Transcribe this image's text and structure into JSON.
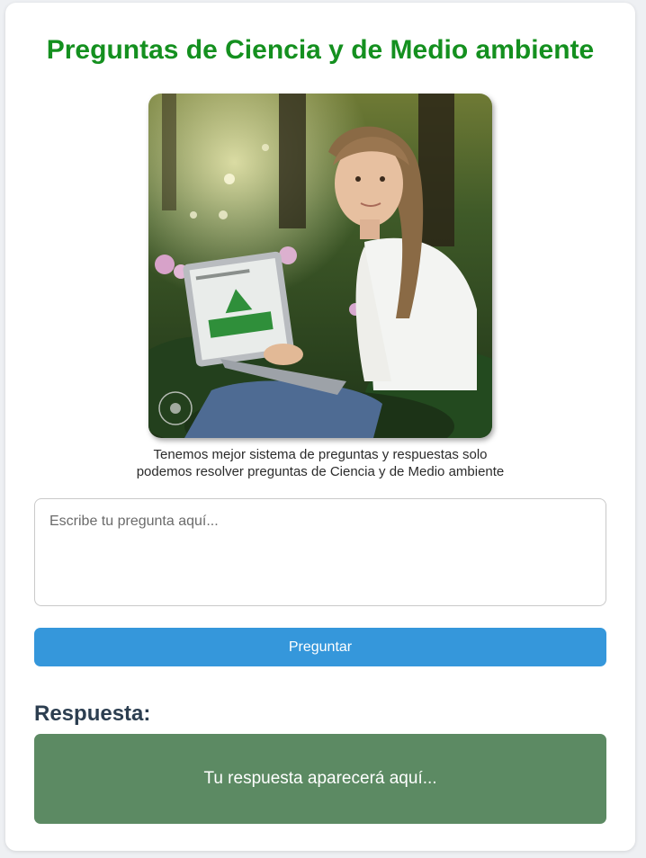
{
  "page": {
    "title": "Preguntas de Ciencia y de Medio ambiente",
    "image_alt": "Niña sentada en un jardín con una laptop",
    "caption_line1": "Tenemos mejor sistema de preguntas y respuestas solo",
    "caption_line2": "podemos resolver preguntas de Ciencia y de Medio ambiente"
  },
  "question": {
    "placeholder": "Escribe tu pregunta aquí...",
    "value": ""
  },
  "ask_button": {
    "label": "Preguntar"
  },
  "answer": {
    "heading": "Respuesta:",
    "placeholder_text": "Tu respuesta aparecerá aquí..."
  },
  "colors": {
    "title": "#14901f",
    "button": "#3597db",
    "answer_box": "#5c8a63",
    "heading": "#2c3e50"
  }
}
